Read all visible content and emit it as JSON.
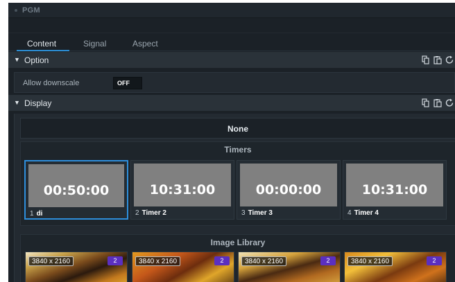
{
  "window": {
    "title": "PGM"
  },
  "tabs": [
    {
      "label": "Content",
      "active": true
    },
    {
      "label": "Signal",
      "active": false
    },
    {
      "label": "Aspect",
      "active": false
    }
  ],
  "option": {
    "header": "Option",
    "rows": [
      {
        "label": "Allow downscale",
        "toggle": "OFF"
      }
    ]
  },
  "display": {
    "header": "Display",
    "none_label": "None",
    "timers": {
      "title": "Timers",
      "items": [
        {
          "index": "1",
          "name": "di",
          "time": "00:50:00",
          "selected": true
        },
        {
          "index": "2",
          "name": "Timer 2",
          "time": "10:31:00",
          "selected": false
        },
        {
          "index": "3",
          "name": "Timer 3",
          "time": "00:00:00",
          "selected": false
        },
        {
          "index": "4",
          "name": "Timer 4",
          "time": "10:31:00",
          "selected": false
        }
      ]
    },
    "image_library": {
      "title": "Image Library",
      "items": [
        {
          "resolution": "3840 x 2160",
          "badge": "2"
        },
        {
          "resolution": "3840 x 2160",
          "badge": "2"
        },
        {
          "resolution": "3840 x 2160",
          "badge": "2"
        },
        {
          "resolution": "3840 x 2160",
          "badge": "2"
        }
      ]
    }
  },
  "header_icons": [
    "copy-icon",
    "paste-icon",
    "reset-icon"
  ],
  "colors": {
    "accent": "#2e8fdc",
    "background": "#1b2127",
    "badge": "#5b2fc0",
    "timer_screen": "#808080"
  }
}
